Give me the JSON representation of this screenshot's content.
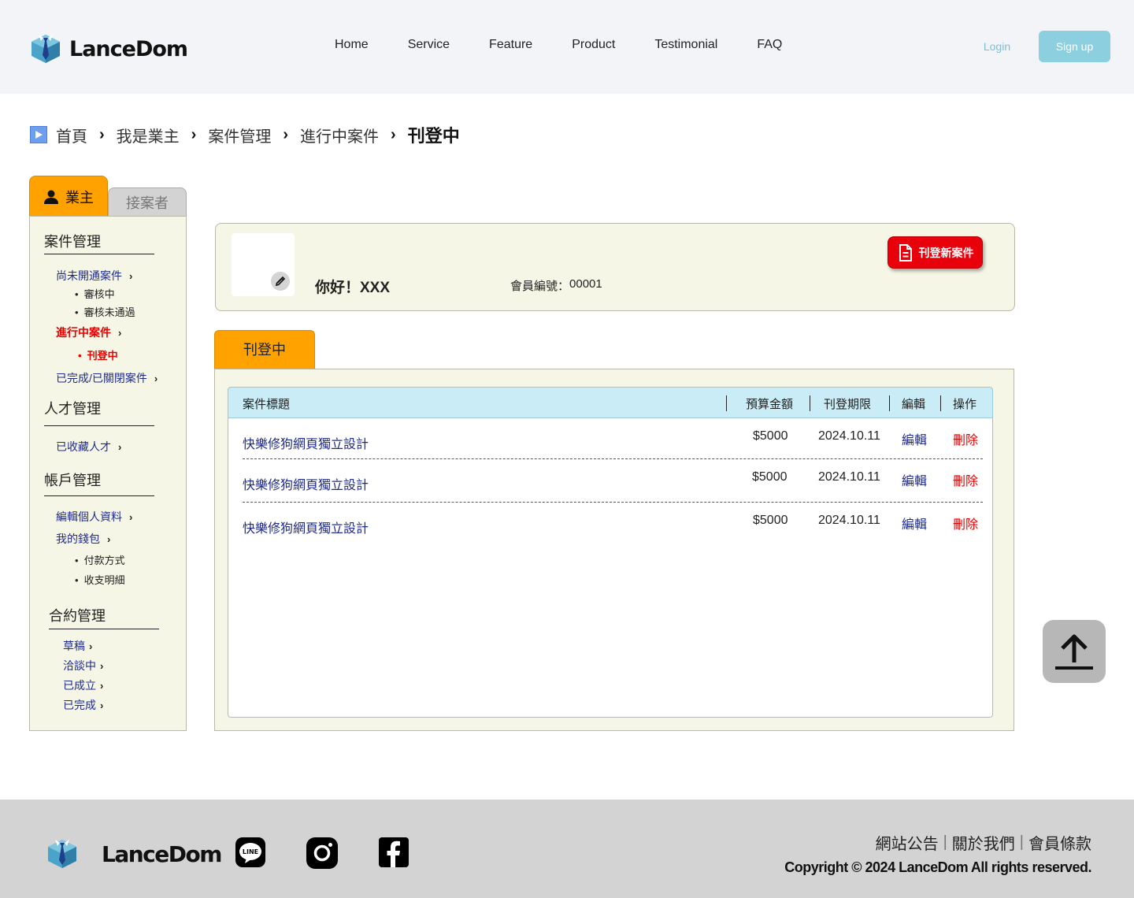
{
  "header": {
    "brand": "LanceDom",
    "nav": [
      "Home",
      "Service",
      "Feature",
      "Product",
      "Testimonial",
      "FAQ"
    ],
    "login_label": "Login",
    "signup_label": "Sign up"
  },
  "breadcrumb": {
    "items": [
      "首頁",
      "我是業主",
      "案件管理",
      "進行中案件"
    ],
    "current": "刊登中"
  },
  "sidebar": {
    "tabs": {
      "owner": "業主",
      "taker": "接案者"
    },
    "sections": {
      "case_management": {
        "title": "案件管理",
        "not_opened": "尚未開通案件",
        "not_opened_subs": [
          "審核中",
          "審核未通過"
        ],
        "in_progress": "進行中案件",
        "in_progress_subs": [
          "刊登中"
        ],
        "completed": "已完成/已關閉案件"
      },
      "talent_management": {
        "title": "人才管理",
        "saved": "已收藏人才"
      },
      "account_management": {
        "title": "帳戶管理",
        "edit_profile": "編輯個人資料",
        "wallet": "我的錢包",
        "wallet_subs": [
          "付款方式",
          "收支明細"
        ]
      },
      "contract_management": {
        "title": "合約管理",
        "items": [
          "草稿",
          "洽談中",
          "已成立",
          "已完成"
        ]
      }
    }
  },
  "profile": {
    "greeting": "你好！XXX",
    "member_label": "會員編號：",
    "member_id": "00001",
    "post_button": "刊登新案件"
  },
  "content_tab": "刊登中",
  "table": {
    "headers": [
      "案件標題",
      "預算金額",
      "刊登期限",
      "編輯",
      "操作"
    ],
    "rows": [
      {
        "title": "快樂修狗網頁獨立設計",
        "budget": "$5000",
        "deadline": "2024.10.11",
        "edit": "編輯",
        "action": "刪除"
      },
      {
        "title": "快樂修狗網頁獨立設計",
        "budget": "$5000",
        "deadline": "2024.10.11",
        "edit": "編輯",
        "action": "刪除"
      },
      {
        "title": "快樂修狗網頁獨立設計",
        "budget": "$5000",
        "deadline": "2024.10.11",
        "edit": "編輯",
        "action": "刪除"
      }
    ]
  },
  "footer": {
    "brand": "LanceDom",
    "links": [
      "網站公告",
      "關於我們",
      "會員條款"
    ],
    "copyright": "Copyright © 2024 LanceDom All rights reserved."
  },
  "colors": {
    "header_bg": "#f2f4f8",
    "accent_orange": "#ffa200",
    "panel_bg": "#f6f6e6",
    "table_header_bg": "#c9ecf6",
    "link_blue": "#1f2b8c",
    "danger_red": "#e60000",
    "signup_bg": "#8ccfdf",
    "footer_bg": "#d3d3d3"
  },
  "icons": [
    "logo-icon",
    "breadcrumb-play-icon",
    "chevron-right-icon",
    "user-icon",
    "pencil-icon",
    "document-icon",
    "arrow-up-icon",
    "line-icon",
    "instagram-icon",
    "facebook-icon"
  ]
}
